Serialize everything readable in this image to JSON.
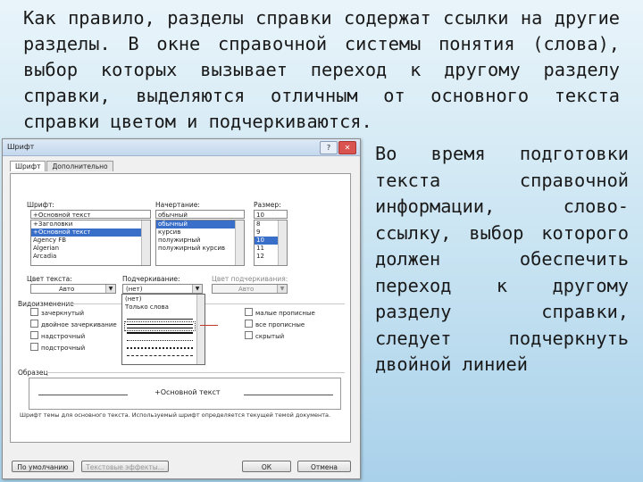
{
  "intro_text": "Как правило, разделы справки содержат ссылки на другие разделы. В окне справочной системы понятия (слова), выбор которых вызывает переход к другому разделу справки, выделяются отличным от основного текста справки цветом и подчеркиваются.",
  "side_text": "Во время подготовки текста справочной информации, слово-ссылку, выбор которого должен обеспечить переход к другому разделу справки, следует подчеркнуть двойной линией",
  "dialog": {
    "title": "Шрифт",
    "help_btn": "?",
    "close_btn": "✕",
    "tabs": [
      "Шрифт",
      "Дополнительно"
    ],
    "font_label": "Шрифт:",
    "font_value": "+Основной текст",
    "font_list": [
      "+Заголовки",
      "+Основной текст",
      "Agency FB",
      "Algerian",
      "Arcadia"
    ],
    "style_label": "Начертание:",
    "style_value": "обычный",
    "style_list": [
      "обычный",
      "курсив",
      "полужирный",
      "полужирный курсив"
    ],
    "size_label": "Размер:",
    "size_value": "10",
    "size_list": [
      "8",
      "9",
      "10",
      "11",
      "12"
    ],
    "color_label": "Цвет текста:",
    "color_value": "Авто",
    "underline_label": "Подчеркивание:",
    "underline_value": "(нет)",
    "ucolor_label": "Цвет подчеркивания:",
    "ucolor_value": "Авто",
    "effects_label": "Видоизменение",
    "effects_left": [
      "зачеркнутый",
      "двойное зачеркивание",
      "надстрочный",
      "подстрочный"
    ],
    "effects_right": [
      "малые прописные",
      "все прописные",
      "скрытый"
    ],
    "underline_options": [
      "(нет)",
      "Только слова"
    ],
    "sample_label": "Образец",
    "sample_text": "+Основной текст",
    "info_text": "Шрифт темы для основного текста. Используемый шрифт определяется текущей темой документа.",
    "default_btn": "По умолчанию",
    "effects_btn": "Текстовые эффекты...",
    "ok_btn": "ОК",
    "cancel_btn": "Отмена"
  }
}
